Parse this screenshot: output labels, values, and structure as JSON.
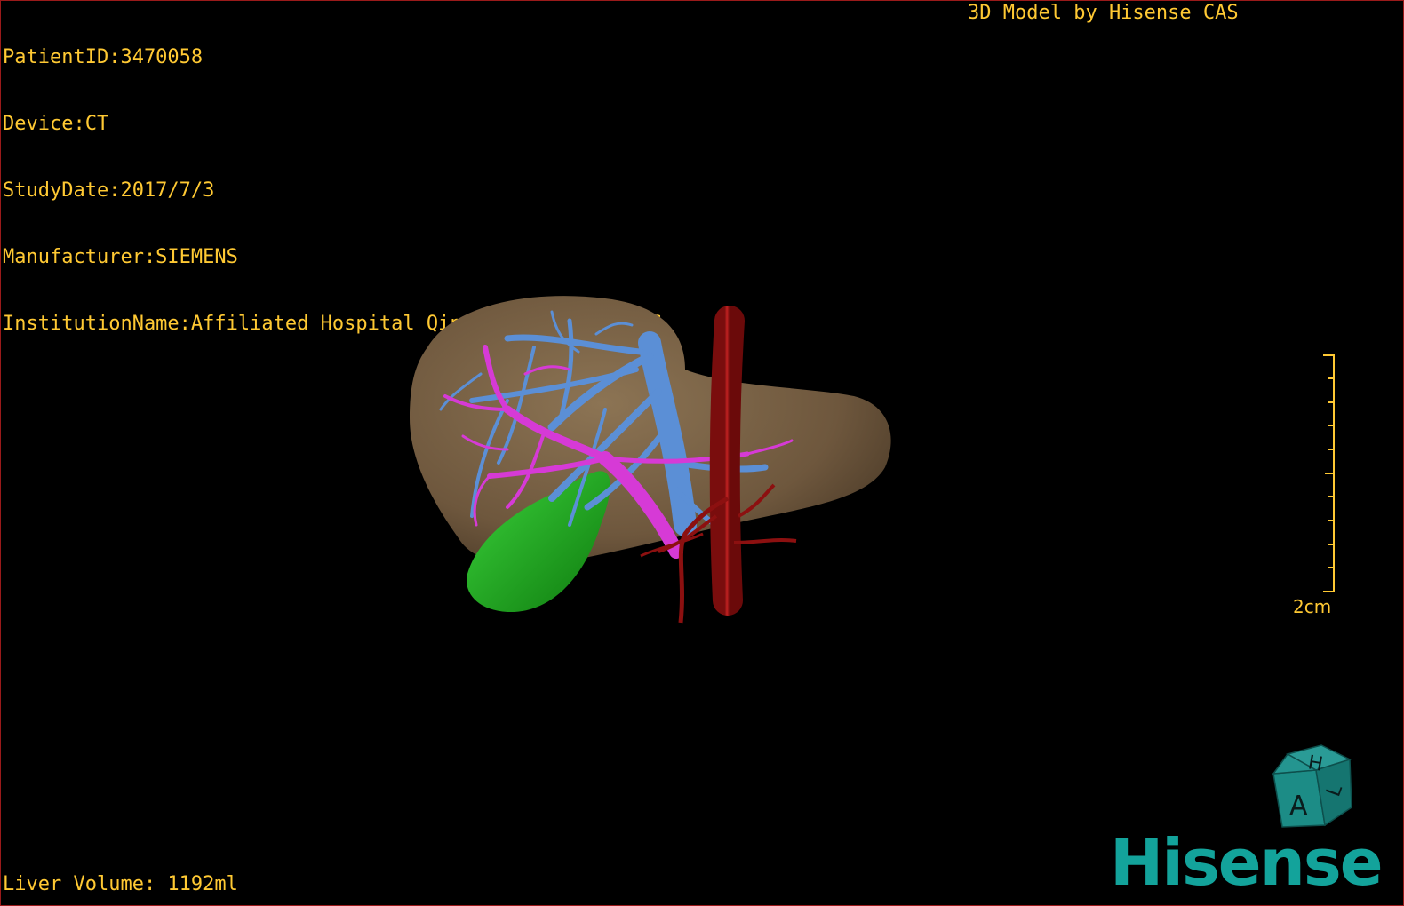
{
  "patient_info": {
    "patient_id": "PatientID:3470058",
    "device": "Device:CT",
    "study_date": "StudyDate:2017/7/3",
    "manufacturer": "Manufacturer:SIEMENS",
    "institution": "InstitutionName:Affiliated Hospital Qingdao University-C"
  },
  "model_credit": "3D Model by Hisense CAS",
  "liver_volume": "Liver Volume: 1192ml",
  "scale_bar": {
    "label": "2cm"
  },
  "orientation_cube": {
    "faces": [
      "H",
      "A",
      "L"
    ]
  },
  "brand": "Hisense",
  "colors": {
    "overlay_text": "#ffc933",
    "liver": "#7a6347",
    "portal_vein": "#d63ad6",
    "hepatic_vein": "#5b8fd6",
    "artery": "#a31818",
    "gallbladder": "#1fb51f",
    "brand": "#13a39b",
    "border": "#9a1a1a"
  }
}
